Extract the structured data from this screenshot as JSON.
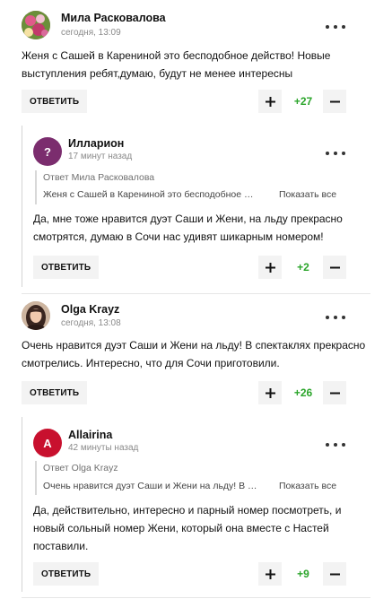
{
  "comments": [
    {
      "author": "Мила Расковалова",
      "time": "сегодня, 13:09",
      "text": "Женя с Сашей в Карениной это бесподобное действо! Новые выступления ребят,думаю, будут не менее интересны",
      "reply_label": "ОТВЕТИТЬ",
      "votes": "+27",
      "avatar_icon": "floral-photo"
    },
    {
      "author": "Илларион",
      "time": "17 минут назад",
      "avatar_letter": "?",
      "avatar_color": "#7b2d6e",
      "quote_prefix": "Ответ",
      "quote_author": "Мила Расковалова",
      "quote_text": "Женя с Сашей в Карениной это бесподобное …",
      "show_all": "Показать все",
      "text": "Да, мне тоже нравится дуэт Саши и Жени, на льду прекрасно смотрятся, думаю в Сочи нас удивят шикарным номером!",
      "reply_label": "ОТВЕТИТЬ",
      "votes": "+2"
    },
    {
      "author": "Olga Krayz",
      "time": "сегодня, 13:08",
      "text": "Очень нравится дуэт Саши и Жени на льду! В спектаклях прекрасно смотрелись. Интересно, что для Сочи приготовили.",
      "reply_label": "ОТВЕТИТЬ",
      "votes": "+26",
      "avatar_icon": "woman-portrait"
    },
    {
      "author": "Allairina",
      "time": "42 минуты назад",
      "avatar_letter": "A",
      "avatar_color": "#c8102e",
      "quote_prefix": "Ответ",
      "quote_author": "Olga Krayz",
      "quote_text": "Очень нравится дуэт Саши и Жени на льду! В …",
      "show_all": "Показать все",
      "text": "Да, действительно, интересно и парный номер посмотреть, и новый сольный номер Жени, который она вместе с Настей поставили.",
      "reply_label": "ОТВЕТИТЬ",
      "votes": "+9"
    }
  ],
  "colors": {
    "positive": "#2ba52b",
    "button_bg": "#f3f3f3"
  }
}
